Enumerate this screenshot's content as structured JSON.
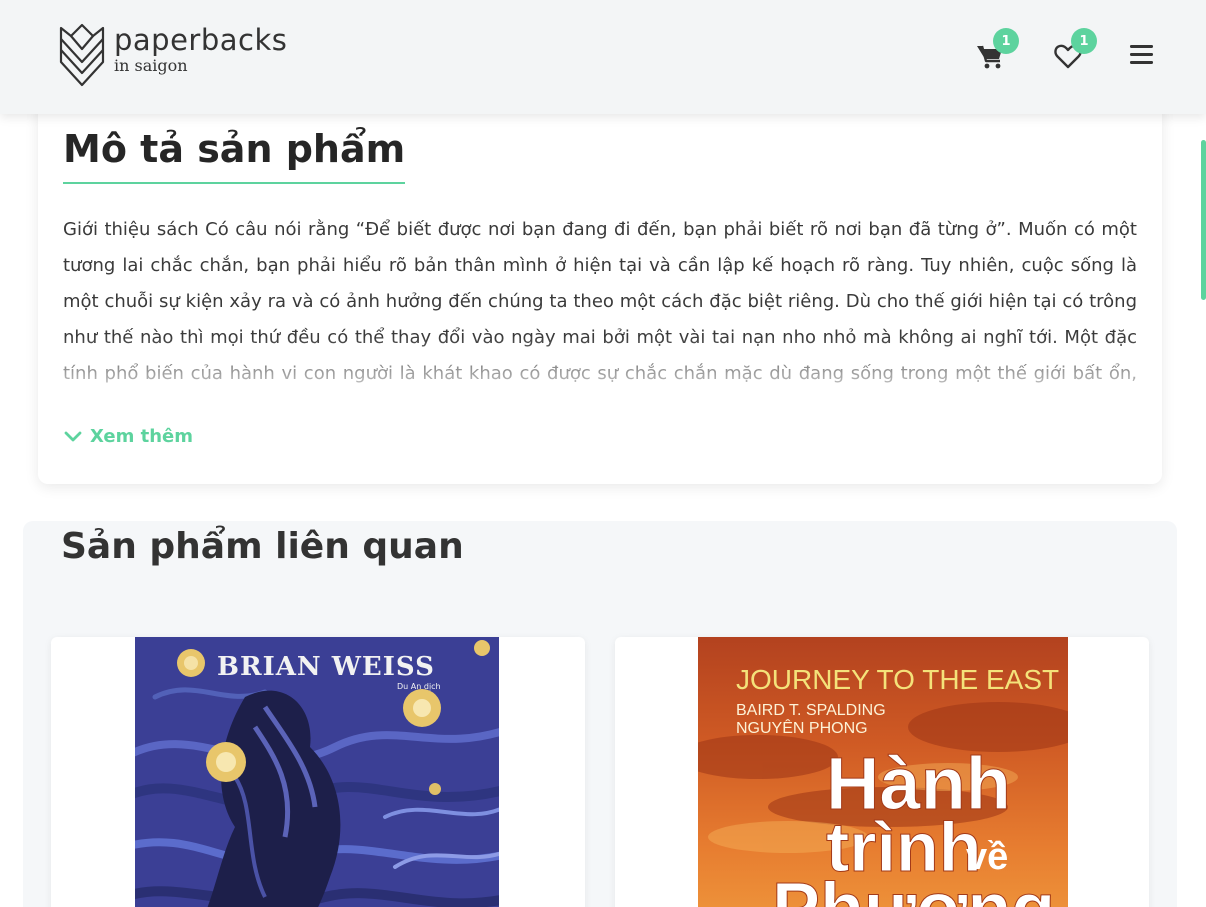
{
  "header": {
    "logo_name": "paperbacks",
    "logo_sub": "in saigon",
    "cart_count": "1",
    "wishlist_count": "1",
    "accent_color": "#5dd39e"
  },
  "description": {
    "title": "Mô tả sản phẩm",
    "text": "Giới thiệu sách Có câu nói rằng “Để biết được nơi bạn đang đi đến, bạn phải biết rõ nơi bạn đã từng ở”. Muốn có một tương lai chắc chắn, bạn phải hiểu rõ bản thân mình ở hiện tại và cần lập kế hoạch rõ ràng. Tuy nhiên, cuộc sống là một chuỗi sự kiện xảy ra và có ảnh hưởng đến chúng ta theo một cách đặc biệt riêng. Dù cho thế giới hiện tại có trông như thế nào thì mọi thứ đều có thể thay đổi vào ngày mai bởi một vài tai nạn nho nhỏ mà không ai nghĩ tới. Một đặc tính phổ biến của hành vi con người là khát khao có được sự chắc chắn mặc dù đang sống trong một thế giới bất ổn, phức tạp và",
    "see_more": "Xem thêm"
  },
  "related": {
    "title": "Sản phẩm liên quan",
    "products": [
      {
        "cover_author": "BRIAN WEISS",
        "cover_translator": "Du An dịch"
      },
      {
        "cover_series": "JOURNEY TO THE EAST",
        "cover_author_1": "BAIRD T. SPALDING",
        "cover_author_2": "NGUYÊN PHONG",
        "cover_title_1": "Hành",
        "cover_title_2": "trình",
        "cover_title_3": "về",
        "cover_title_4": "Phương"
      }
    ]
  }
}
